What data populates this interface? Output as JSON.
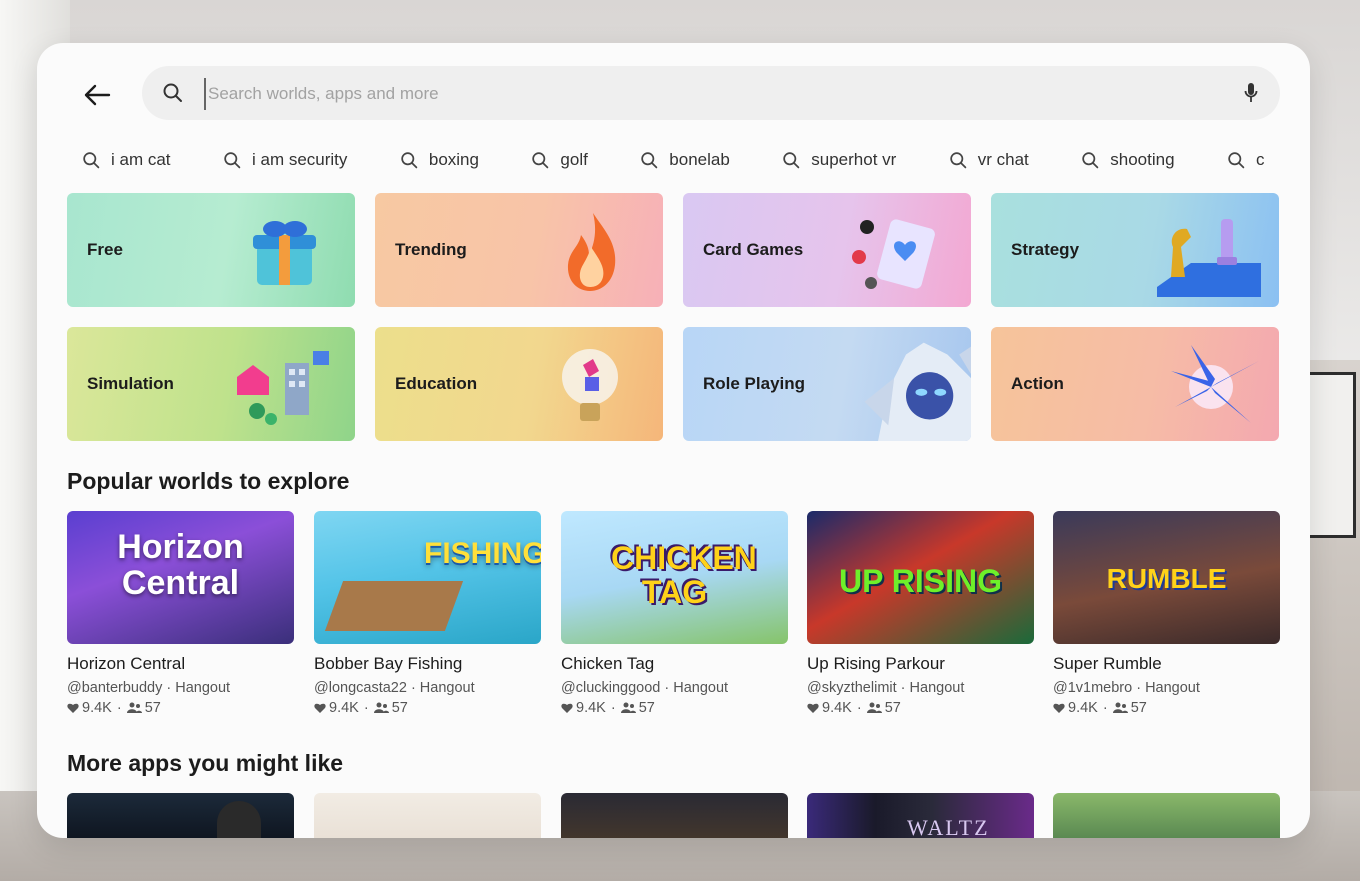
{
  "search": {
    "placeholder": "Search worlds, apps and more"
  },
  "suggestions": [
    "i am cat",
    "i am security",
    "boxing",
    "golf",
    "bonelab",
    "superhot vr",
    "vr chat",
    "shooting",
    "c"
  ],
  "categories": [
    {
      "label": "Free"
    },
    {
      "label": "Trending"
    },
    {
      "label": "Card Games"
    },
    {
      "label": "Strategy"
    },
    {
      "label": "Simulation"
    },
    {
      "label": "Education"
    },
    {
      "label": "Role Playing"
    },
    {
      "label": "Action"
    }
  ],
  "popular": {
    "title": "Popular worlds to explore",
    "items": [
      {
        "thumb_text": "Horizon Central",
        "name": "Horizon Central",
        "meta": "@banterbuddy · Hangout",
        "likes": "9.4K",
        "players": "57"
      },
      {
        "thumb_text": "FISHING",
        "name": "Bobber Bay Fishing",
        "meta": "@longcasta22 · Hangout",
        "likes": "9.4K",
        "players": "57"
      },
      {
        "thumb_text": "CHICKEN TAG",
        "name": "Chicken Tag",
        "meta": "@cluckinggood · Hangout",
        "likes": "9.4K",
        "players": "57"
      },
      {
        "thumb_text": "UP RISING",
        "name": "Up Rising Parkour",
        "meta": "@skyzthelimit · Hangout",
        "likes": "9.4K",
        "players": "57"
      },
      {
        "thumb_text": "RUMBLE",
        "name": "Super Rumble",
        "meta": "@1v1mebro · Hangout",
        "likes": "9.4K",
        "players": "57"
      }
    ]
  },
  "more_apps": {
    "title": "More apps you might like",
    "items": [
      {
        "thumb_text": ""
      },
      {
        "thumb_text": ""
      },
      {
        "thumb_text": ""
      },
      {
        "thumb_text": "WALTZ"
      },
      {
        "thumb_text": ""
      }
    ]
  }
}
